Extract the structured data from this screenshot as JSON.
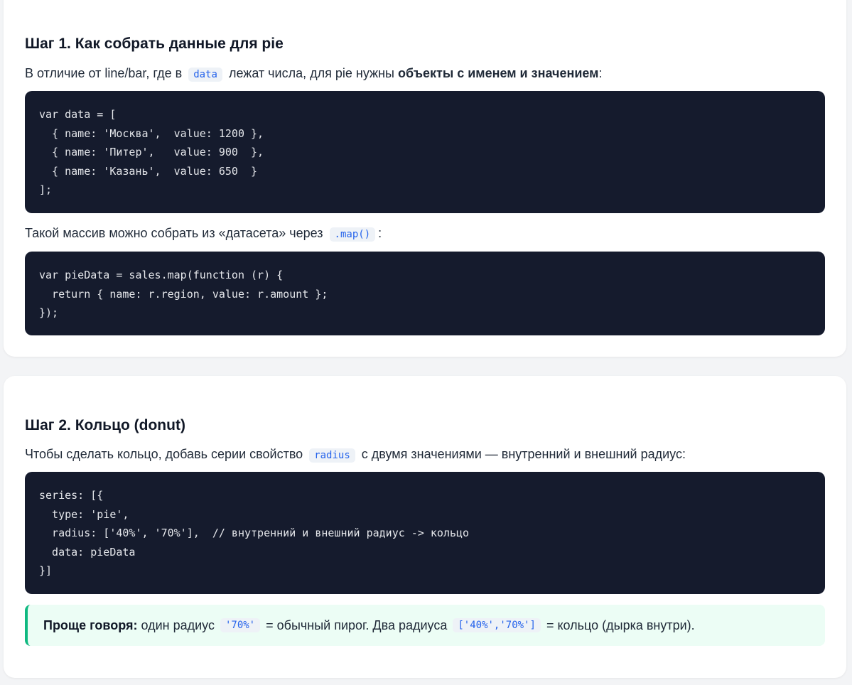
{
  "step1": {
    "title": "Шаг 1. Как собрать данные для pie",
    "intro_part1": "В отличие от line/bar, где в",
    "intro_code": "data",
    "intro_part2": "лежат числа, для pie нужны",
    "intro_bold": "объекты с именем и значением",
    "intro_end": ":",
    "code1": "var data = [\n  { name: 'Москва',  value: 1200 },\n  { name: 'Питер',   value: 900  },\n  { name: 'Казань',  value: 650  }\n];",
    "text2_part1": "Такой массив можно собрать из «датасета» через",
    "text2_code": ".map()",
    "text2_end": ":",
    "code2": "var pieData = sales.map(function (r) {\n  return { name: r.region, value: r.amount };\n});"
  },
  "step2": {
    "title": "Шаг 2. Кольцо (donut)",
    "intro_part1": "Чтобы сделать кольцо, добавь серии свойство",
    "intro_code": "radius",
    "intro_part2": "с двумя значениями — внутренний и внешний радиус:",
    "code": "series: [{\n  type: 'pie',\n  radius: ['40%', '70%'],  // внутренний и внешний радиус -> кольцо\n  data: pieData\n}]",
    "note_bold": "Проще говоря:",
    "note_part1": "один радиус",
    "note_code1": "'70%'",
    "note_part2": "= обычный пирог. Два радиуса",
    "note_code2": "['40%','70%']",
    "note_part3": "= кольцо (дырка внутри)."
  }
}
